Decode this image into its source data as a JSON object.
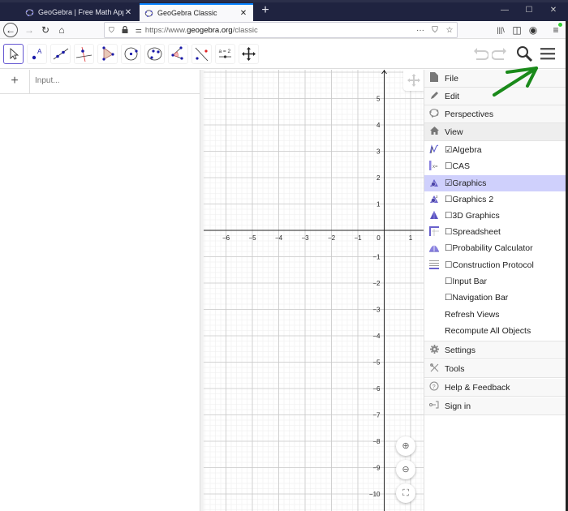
{
  "browser": {
    "tabs": [
      {
        "title": "GeoGebra | Free Math Apps - u",
        "active": false,
        "close": "✕"
      },
      {
        "title": "GeoGebra Classic",
        "active": true,
        "close": "✕"
      }
    ],
    "new_tab": "+",
    "window_controls": {
      "minimize": "—",
      "maximize": "☐",
      "close": "✕"
    },
    "nav": {
      "back": "←",
      "forward": "→",
      "reload": "↻",
      "home": "⌂"
    },
    "url_prefix": "https://www.",
    "url_domain": "geogebra.org",
    "url_path": "/classic",
    "url_icons": {
      "shield": "⛉",
      "lock": "🔒",
      "perm": "⚌"
    },
    "url_right_icons": {
      "more": "···",
      "pocket": "⛉",
      "bookmark": "☆"
    },
    "toolbar_right_icons": {
      "library": "|||\\",
      "sidebar": "◫",
      "account": "◉",
      "menu": "≡"
    }
  },
  "ggb_toolbar": {
    "tools": [
      "Move",
      "Point",
      "Line",
      "Perpendicular Line",
      "Polygon",
      "Circle with Center through Point",
      "Circle through 3 Points",
      "Angle",
      "Reflect about Line",
      "Slider",
      "Move Graphics View"
    ],
    "slider_label": "a = 2",
    "undo": "↶",
    "redo": "↷",
    "search": "search",
    "menu": "menu"
  },
  "algebra": {
    "add": "+",
    "input_placeholder": "Input..."
  },
  "graphics": {
    "x_ticks": [
      "−6",
      "−5",
      "−4",
      "−3",
      "−2",
      "−1",
      "0",
      "1"
    ],
    "y_ticks_pos": [
      "5",
      "4",
      "3",
      "2",
      "1"
    ],
    "y_ticks_neg": [
      "−1",
      "−2",
      "−3",
      "−4",
      "−5",
      "−6",
      "−7",
      "−8",
      "−9",
      "−10"
    ],
    "zoom_in": "⊕",
    "zoom_out": "⊖",
    "fullscreen": "⛶"
  },
  "menu": {
    "items": [
      {
        "label": "File",
        "icon": "file-icon"
      },
      {
        "label": "Edit",
        "icon": "pencil-icon"
      },
      {
        "label": "Perspectives",
        "icon": "perspectives-icon"
      },
      {
        "label": "View",
        "icon": "home-icon"
      }
    ],
    "view_items": [
      {
        "label": "☑Algebra",
        "icon": "algebra-view-icon",
        "checked": true
      },
      {
        "label": "☐CAS",
        "icon": "cas-view-icon",
        "checked": false
      },
      {
        "label": "☑Graphics",
        "icon": "graphics-view-icon",
        "checked": true,
        "highlighted": true
      },
      {
        "label": "☐Graphics 2",
        "icon": "graphics2-view-icon",
        "checked": false
      },
      {
        "label": "☐3D Graphics",
        "icon": "3d-graphics-icon",
        "checked": false
      },
      {
        "label": "☐Spreadsheet",
        "icon": "spreadsheet-icon",
        "checked": false
      },
      {
        "label": "☐Probability Calculator",
        "icon": "probability-icon",
        "checked": false
      },
      {
        "label": "☐Construction Protocol",
        "icon": "construction-protocol-icon",
        "checked": false
      },
      {
        "label": "☐Input Bar",
        "icon": "",
        "checked": false
      },
      {
        "label": "☐Navigation Bar",
        "icon": "",
        "checked": false
      }
    ],
    "actions": [
      "Refresh Views",
      "Recompute All Objects"
    ],
    "bottom_items": [
      {
        "label": "Settings",
        "icon": "gear-icon"
      },
      {
        "label": "Tools",
        "icon": "tools-icon"
      },
      {
        "label": "Help & Feedback",
        "icon": "help-icon"
      },
      {
        "label": "Sign in",
        "icon": "sign-in-icon"
      }
    ]
  },
  "colors": {
    "accent": "#6557d2",
    "highlight": "#cfd0fc",
    "annotation_arrow": "#1a8a1a",
    "point": "#1a1aa8",
    "titlebar": "#1f2340"
  }
}
